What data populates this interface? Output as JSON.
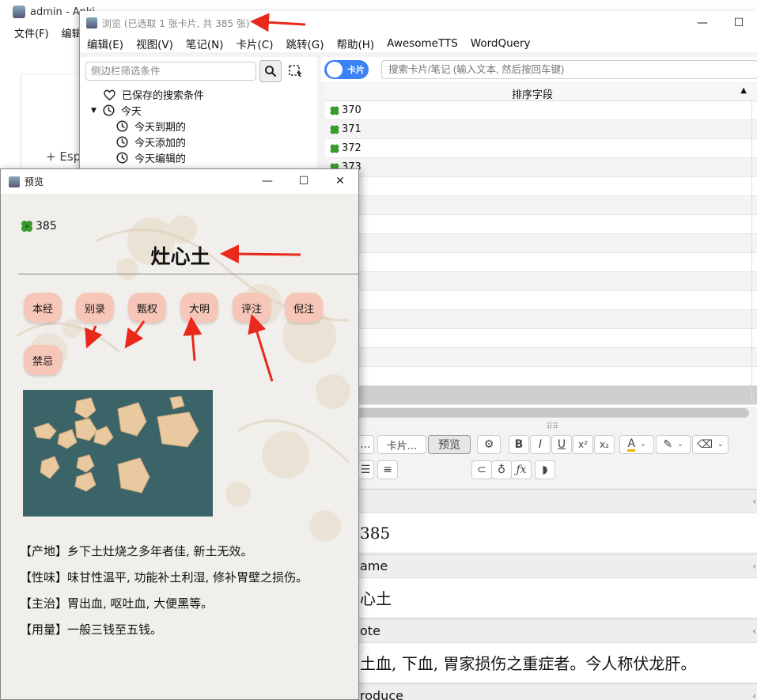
{
  "main_window": {
    "title": "admin - Anki",
    "menu": [
      "文件(F)",
      "编辑"
    ],
    "deck_item": "+  Esp"
  },
  "browse_window": {
    "title": "浏览 (已选取 1 张卡片, 共 385 张)",
    "menu": [
      "编辑(E)",
      "视图(V)",
      "笔记(N)",
      "卡片(C)",
      "跳转(G)",
      "帮助(H)",
      "AwesomeTTS",
      "WordQuery"
    ],
    "sidebar": {
      "search_placeholder": "侧边栏筛选条件",
      "saved_searches": "已保存的搜索条件",
      "today": "今天",
      "due_today": "今天到期的",
      "added_today": "今天添加的",
      "edited_today": "今天编辑的"
    },
    "toggle_label": "卡片",
    "search_placeholder": "搜索卡片/笔记 (输入文本, 然后按回车键)",
    "table": {
      "sort_column": "排序字段",
      "rows": [
        "370",
        "371",
        "372",
        "373",
        "",
        "",
        "",
        "",
        "",
        "",
        "",
        "",
        "",
        "",
        "",
        ""
      ]
    },
    "editor": {
      "fields_btn": "...",
      "cards_btn": "卡片...",
      "preview_btn": "预览",
      "field_sections": [
        {
          "name": "",
          "value": "385"
        },
        {
          "name": "ame",
          "value": "心土"
        },
        {
          "name": "ote",
          "value": "土血, 下血, 胃家损伤之重症者。今人称伏龙肝。"
        },
        {
          "name": "roduce",
          "value": ""
        }
      ]
    }
  },
  "preview_window": {
    "title": "预览",
    "card_id": "385",
    "card_title": "灶心土",
    "tags": [
      "本经",
      "别录",
      "甄权",
      "大明",
      "评注",
      "倪注",
      "禁忌"
    ],
    "info": [
      "【产地】乡下土灶烧之多年者佳, 新土无效。",
      "【性味】味甘性温平, 功能补土利湿, 修补胃壁之损伤。",
      "【主治】胃出血, 呕吐血, 大便黑等。",
      "【用量】一般三钱至五钱。"
    ]
  },
  "colors": {
    "tag_bg": "#f6c7b8",
    "toggle_blue": "#3b82f6",
    "arrow_red": "#e8291c",
    "clover_green": "#3a9a2e"
  }
}
